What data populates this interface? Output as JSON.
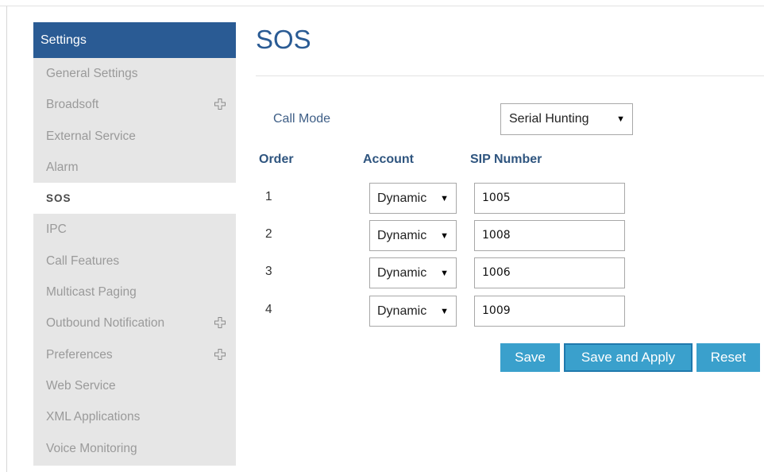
{
  "sidebar": {
    "header": "Settings",
    "items": [
      {
        "label": "General Settings",
        "expandable": false,
        "active": false
      },
      {
        "label": "Broadsoft",
        "expandable": true,
        "active": false
      },
      {
        "label": "External Service",
        "expandable": false,
        "active": false
      },
      {
        "label": "Alarm",
        "expandable": false,
        "active": false
      },
      {
        "label": "SOS",
        "expandable": false,
        "active": true
      },
      {
        "label": "IPC",
        "expandable": false,
        "active": false
      },
      {
        "label": "Call Features",
        "expandable": false,
        "active": false
      },
      {
        "label": "Multicast Paging",
        "expandable": false,
        "active": false
      },
      {
        "label": "Outbound Notification",
        "expandable": true,
        "active": false
      },
      {
        "label": "Preferences",
        "expandable": true,
        "active": false
      },
      {
        "label": "Web Service",
        "expandable": false,
        "active": false
      },
      {
        "label": "XML Applications",
        "expandable": false,
        "active": false
      },
      {
        "label": "Voice Monitoring",
        "expandable": false,
        "active": false
      }
    ]
  },
  "page": {
    "title": "SOS"
  },
  "form": {
    "call_mode_label": "Call Mode",
    "call_mode_value": "Serial Hunting",
    "columns": {
      "order": "Order",
      "account": "Account",
      "sip_number": "SIP Number"
    },
    "rows": [
      {
        "order": "1",
        "account": "Dynamic",
        "sip_number": "1005"
      },
      {
        "order": "2",
        "account": "Dynamic",
        "sip_number": "1008"
      },
      {
        "order": "3",
        "account": "Dynamic",
        "sip_number": "1006"
      },
      {
        "order": "4",
        "account": "Dynamic",
        "sip_number": "1009"
      }
    ]
  },
  "buttons": {
    "save": "Save",
    "save_apply": "Save and Apply",
    "reset": "Reset"
  },
  "icons": {
    "expand": "plus-icon",
    "dropdown": "chevron-down-icon"
  },
  "colors": {
    "header_blue": "#2a5b94",
    "button_blue": "#3aa0cc",
    "sidebar_bg": "#e6e6e6"
  }
}
